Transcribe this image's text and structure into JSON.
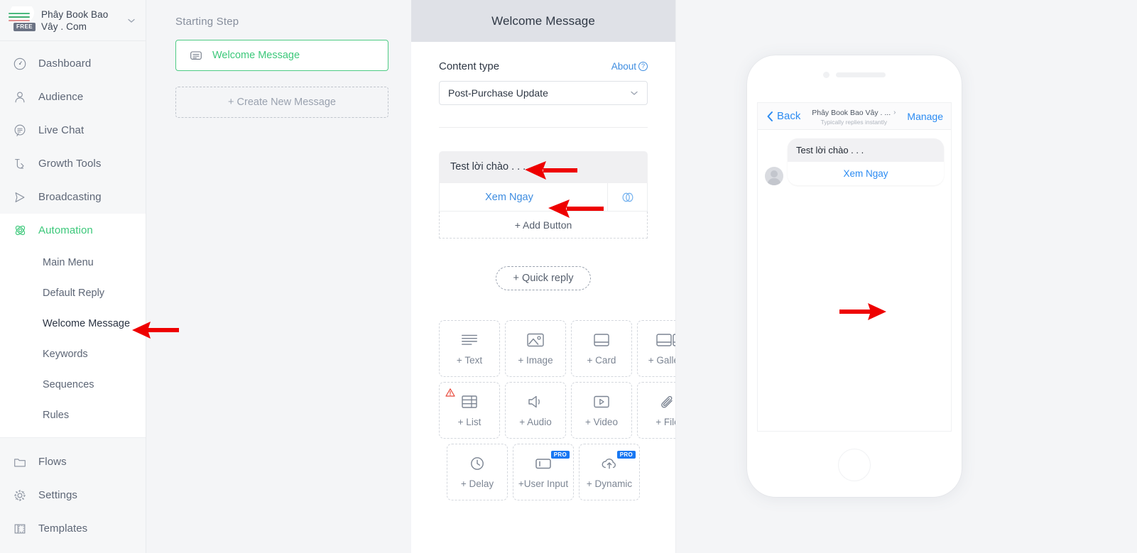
{
  "sidebar": {
    "brand": {
      "name": "Phây Book Bao Vây . Com",
      "badge": "FREE",
      "caret": "⌄"
    },
    "main_items": [
      {
        "label": "Dashboard",
        "icon": "dashboard-gauge-icon"
      },
      {
        "label": "Audience",
        "icon": "user-icon"
      },
      {
        "label": "Live Chat",
        "icon": "chat-bubble-icon"
      },
      {
        "label": "Growth Tools",
        "icon": "growth-arrow-icon"
      },
      {
        "label": "Broadcasting",
        "icon": "send-icon"
      }
    ],
    "automation": {
      "label": "Automation",
      "icon": "atom-icon"
    },
    "sub_items": [
      {
        "label": "Main Menu"
      },
      {
        "label": "Default Reply"
      },
      {
        "label": "Welcome Message"
      },
      {
        "label": "Keywords"
      },
      {
        "label": "Sequences"
      },
      {
        "label": "Rules"
      }
    ],
    "bottom_items": [
      {
        "label": "Flows",
        "icon": "folder-icon"
      },
      {
        "label": "Settings",
        "icon": "gear-icon"
      },
      {
        "label": "Templates",
        "icon": "template-icon"
      }
    ]
  },
  "steps": {
    "title": "Starting Step",
    "active_step": "Welcome Message",
    "create_new": "+ Create New Message"
  },
  "editor": {
    "title": "Welcome Message",
    "content_type_label": "Content type",
    "about_label": "About",
    "content_type_value": "Post-Purchase Update",
    "message": {
      "text": "Test lời chào . . .",
      "button_label": "Xem Ngay",
      "link_icon": "chain-link-icon",
      "add_button": "+ Add Button"
    },
    "quick_reply": "+ Quick reply",
    "tiles_row1": [
      {
        "label": "+ Text",
        "icon": "text-lines-icon"
      },
      {
        "label": "+ Image",
        "icon": "image-icon"
      },
      {
        "label": "+ Card",
        "icon": "card-icon"
      },
      {
        "label": "+ Gallery",
        "icon": "gallery-icon"
      }
    ],
    "tiles_row2": [
      {
        "label": "+ List",
        "icon": "list-table-icon",
        "warning": true
      },
      {
        "label": "+ Audio",
        "icon": "speaker-icon"
      },
      {
        "label": "+ Video",
        "icon": "video-play-icon"
      },
      {
        "label": "+ File",
        "icon": "paperclip-icon"
      }
    ],
    "tiles_row3": [
      {
        "label": "+ Delay",
        "icon": "clock-icon"
      },
      {
        "label": "+User Input",
        "icon": "input-field-icon",
        "pro": "PRO"
      },
      {
        "label": "+ Dynamic",
        "icon": "cloud-upload-icon",
        "pro": "PRO"
      }
    ]
  },
  "preview": {
    "back_label": "Back",
    "page_name": "Phây Book Bao Vây . ...",
    "status": "Typically replies instantly",
    "manage_label": "Manage",
    "bubble_text": "Test lời chào . . .",
    "bubble_button": "Xem Ngay"
  },
  "colors": {
    "accent_green": "#3cc87a",
    "link_blue": "#3d8ce0",
    "annotation_red": "#ee0000",
    "header_gray": "#dfe1e7",
    "page_bg": "#f4f5f7"
  }
}
